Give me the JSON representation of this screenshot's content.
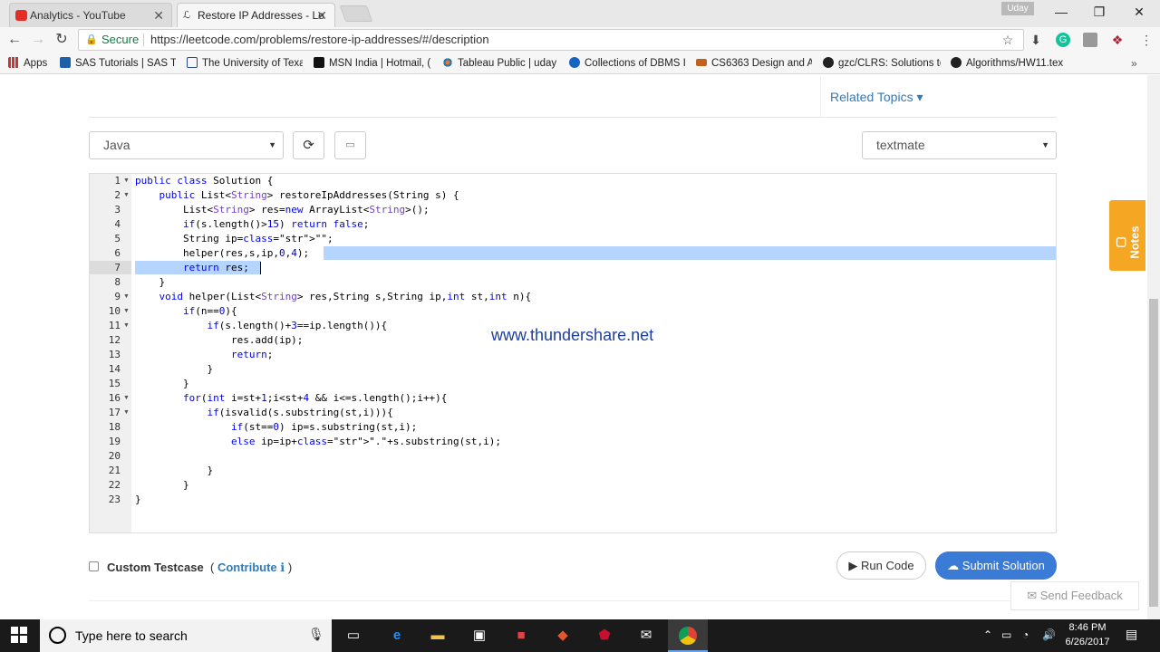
{
  "browser": {
    "tabs": [
      {
        "title": "Analytics - YouTube",
        "icon": "youtube-icon",
        "active": false
      },
      {
        "title": "Restore IP Addresses - Le",
        "icon": "leetcode-icon",
        "active": true
      }
    ],
    "user_badge": "Uday",
    "secure_label": "Secure",
    "url": "https://leetcode.com/problems/restore-ip-addresses/#/description",
    "bookmarks": [
      {
        "label": "Apps",
        "icon": "apps-grid-icon"
      },
      {
        "label": "SAS Tutorials | SAS Tr",
        "icon": "sas-icon"
      },
      {
        "label": "The University of Texa",
        "icon": "b-icon"
      },
      {
        "label": "MSN India | Hotmail, (",
        "icon": "msn-icon"
      },
      {
        "label": "Tableau Public | uday",
        "icon": "tableau-icon"
      },
      {
        "label": "Collections of DBMS I",
        "icon": "info-icon"
      },
      {
        "label": "CS6363 Design and A",
        "icon": "utd-icon"
      },
      {
        "label": "gzc/CLRS: Solutions to",
        "icon": "github-icon"
      },
      {
        "label": "Algorithms/HW11.tex",
        "icon": "github-icon"
      }
    ]
  },
  "page": {
    "related_topics": "Related Topics ▾",
    "language": "Java",
    "theme": "textmate",
    "watermark": "www.thundershare.net",
    "custom_testcase": "Custom Testcase",
    "contribute_open": "( ",
    "contribute_link": "Contribute",
    "contribute_close": " )",
    "run_code": "Run Code",
    "submit_solution": "Submit Solution",
    "send_feedback": "Send Feedback",
    "notes": "Notes"
  },
  "code_lines": [
    "public class Solution {",
    "    public List<String> restoreIpAddresses(String s) {",
    "        List<String> res=new ArrayList<String>();",
    "        if(s.length()>15) return false;",
    "        String ip=\"\";",
    "        helper(res,s,ip,0,4);",
    "        return res;",
    "    }",
    "    void helper(List<String> res,String s,String ip,int st,int n){",
    "        if(n==0){",
    "            if(s.length()+3==ip.length()){",
    "                res.add(ip);",
    "                return;",
    "            }",
    "        }",
    "        for(int i=st+1;i<st+4 && i<=s.length();i++){",
    "            if(isvalid(s.substring(st,i))){",
    "                if(st==0) ip=s.substring(st,i);",
    "                else ip=ip+\".\"+s.substring(st,i);",
    "",
    "            }",
    "        }",
    "}"
  ],
  "fold_lines": [
    1,
    2,
    9,
    10,
    11,
    16,
    17
  ],
  "taskbar": {
    "search_placeholder": "Type here to search",
    "time": "8:46 PM",
    "date": "6/26/2017"
  }
}
